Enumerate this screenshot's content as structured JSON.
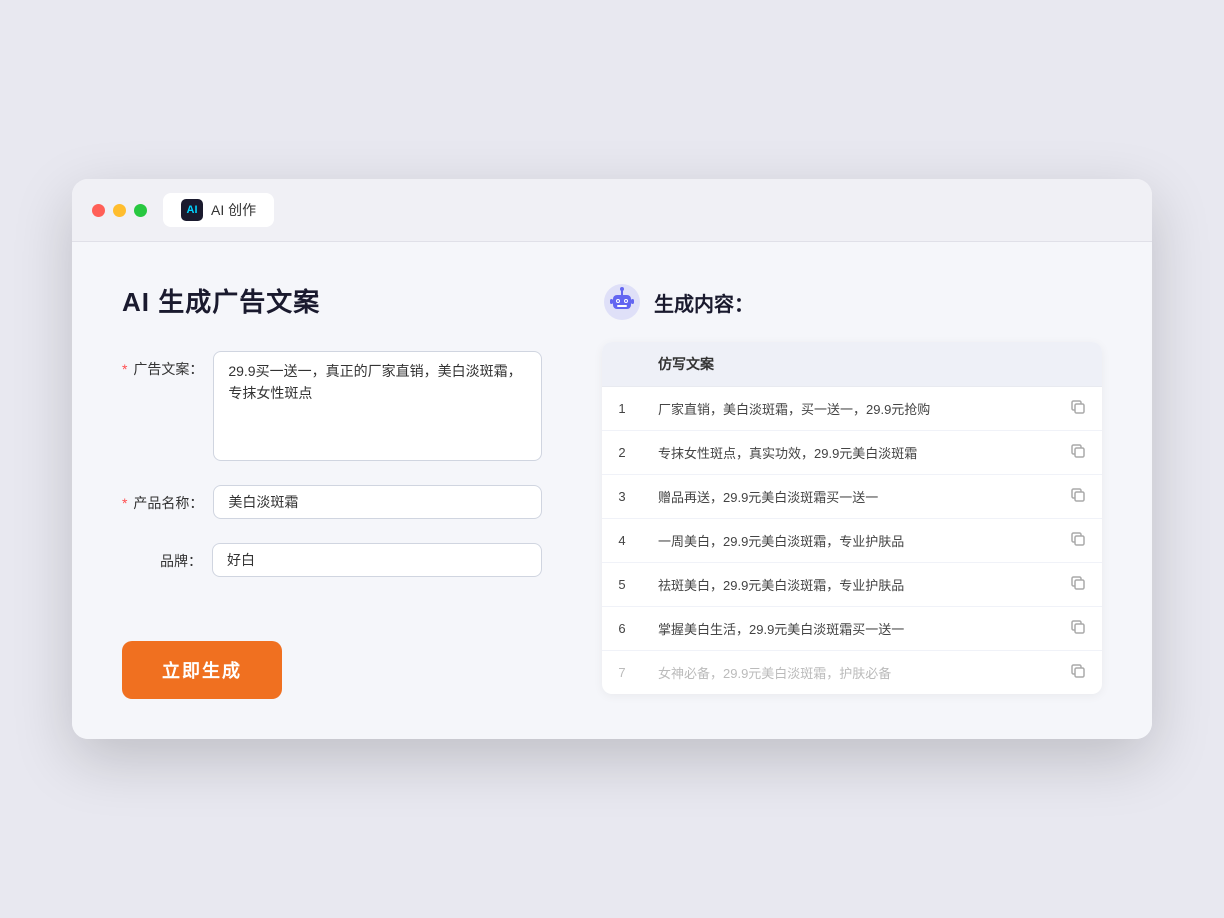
{
  "browser": {
    "tab_label": "AI 创作",
    "tab_icon_text": "AI"
  },
  "left_panel": {
    "title": "AI 生成广告文案",
    "form": {
      "ad_copy_label": "广告文案：",
      "ad_copy_required": true,
      "ad_copy_value": "29.9买一送一，真正的厂家直销，美白淡斑霜，专抹女性斑点",
      "product_name_label": "产品名称：",
      "product_name_required": true,
      "product_name_value": "美白淡斑霜",
      "brand_label": "品牌：",
      "brand_required": false,
      "brand_value": "好白"
    },
    "generate_button": "立即生成"
  },
  "right_panel": {
    "title": "生成内容：",
    "table_header": "仿写文案",
    "results": [
      {
        "num": 1,
        "text": "厂家直销，美白淡斑霜，买一送一，29.9元抢购",
        "faded": false
      },
      {
        "num": 2,
        "text": "专抹女性斑点，真实功效，29.9元美白淡斑霜",
        "faded": false
      },
      {
        "num": 3,
        "text": "赠品再送，29.9元美白淡斑霜买一送一",
        "faded": false
      },
      {
        "num": 4,
        "text": "一周美白，29.9元美白淡斑霜，专业护肤品",
        "faded": false
      },
      {
        "num": 5,
        "text": "祛斑美白，29.9元美白淡斑霜，专业护肤品",
        "faded": false
      },
      {
        "num": 6,
        "text": "掌握美白生活，29.9元美白淡斑霜买一送一",
        "faded": false
      },
      {
        "num": 7,
        "text": "女神必备，29.9元美白淡斑霜，护肤必备",
        "faded": true
      }
    ]
  }
}
